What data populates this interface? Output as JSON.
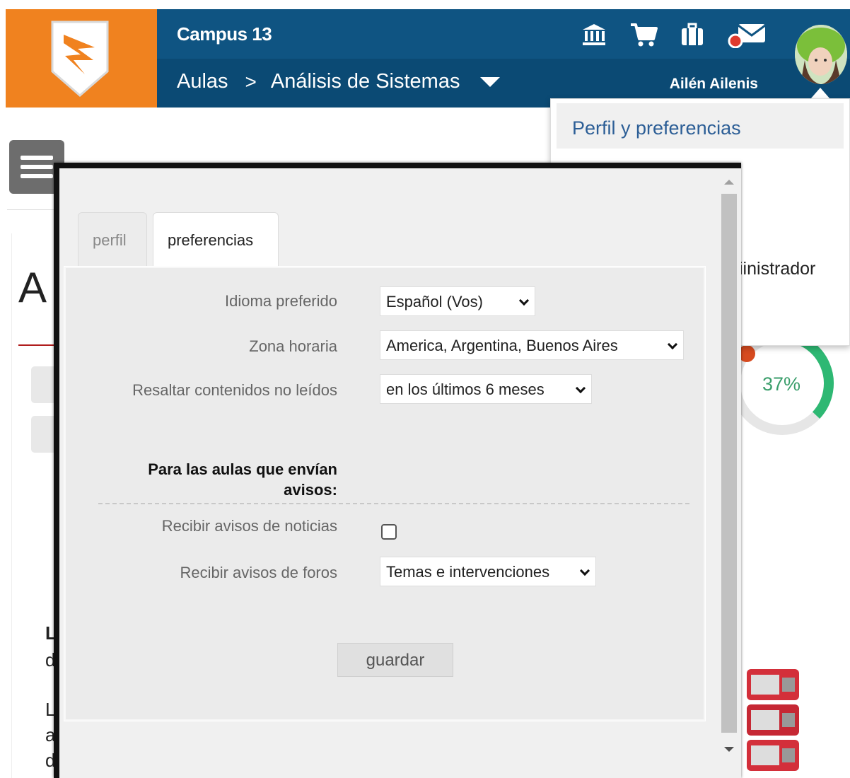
{
  "header": {
    "site_title": "Campus 13",
    "breadcrumb": {
      "root": "Aulas",
      "separator": ">",
      "current": "Análisis de Sistemas"
    },
    "user_name": "Ailén Ailenis",
    "icons": [
      "bank-icon",
      "cart-icon",
      "briefcase-icon",
      "mail-notification-icon"
    ]
  },
  "user_menu": {
    "active_item": "Perfil y preferencias",
    "partial_item": "iinistrador"
  },
  "background": {
    "big_letter": "A",
    "letters": [
      "L",
      "d",
      "L",
      "a",
      "d"
    ],
    "progress_percent": "37%",
    "progress_value": 0.37
  },
  "modal": {
    "tabs": [
      {
        "label": "perfil",
        "active": false
      },
      {
        "label": "preferencias",
        "active": true
      }
    ],
    "fields": {
      "language": {
        "label": "Idioma preferido",
        "value": "Español (Vos)"
      },
      "timezone": {
        "label": "Zona horaria",
        "value": "America, Argentina, Buenos Aires"
      },
      "highlight": {
        "label": "Resaltar contenidos no leídos",
        "value": "en los últimos 6 meses"
      }
    },
    "notices_heading": "Para las aulas que envían avisos:",
    "notices": {
      "news": {
        "label": "Recibir avisos de noticias",
        "checked": false
      },
      "forums": {
        "label": "Recibir avisos de foros",
        "value": "Temas e intervenciones"
      }
    },
    "save_label": "guardar"
  },
  "colors": {
    "brand_orange": "#f0821f",
    "header_blue": "#0f5482",
    "header_blue_dark": "#0b4a74",
    "link_blue": "#2c5e96",
    "progress_green": "#3a9e6b"
  }
}
